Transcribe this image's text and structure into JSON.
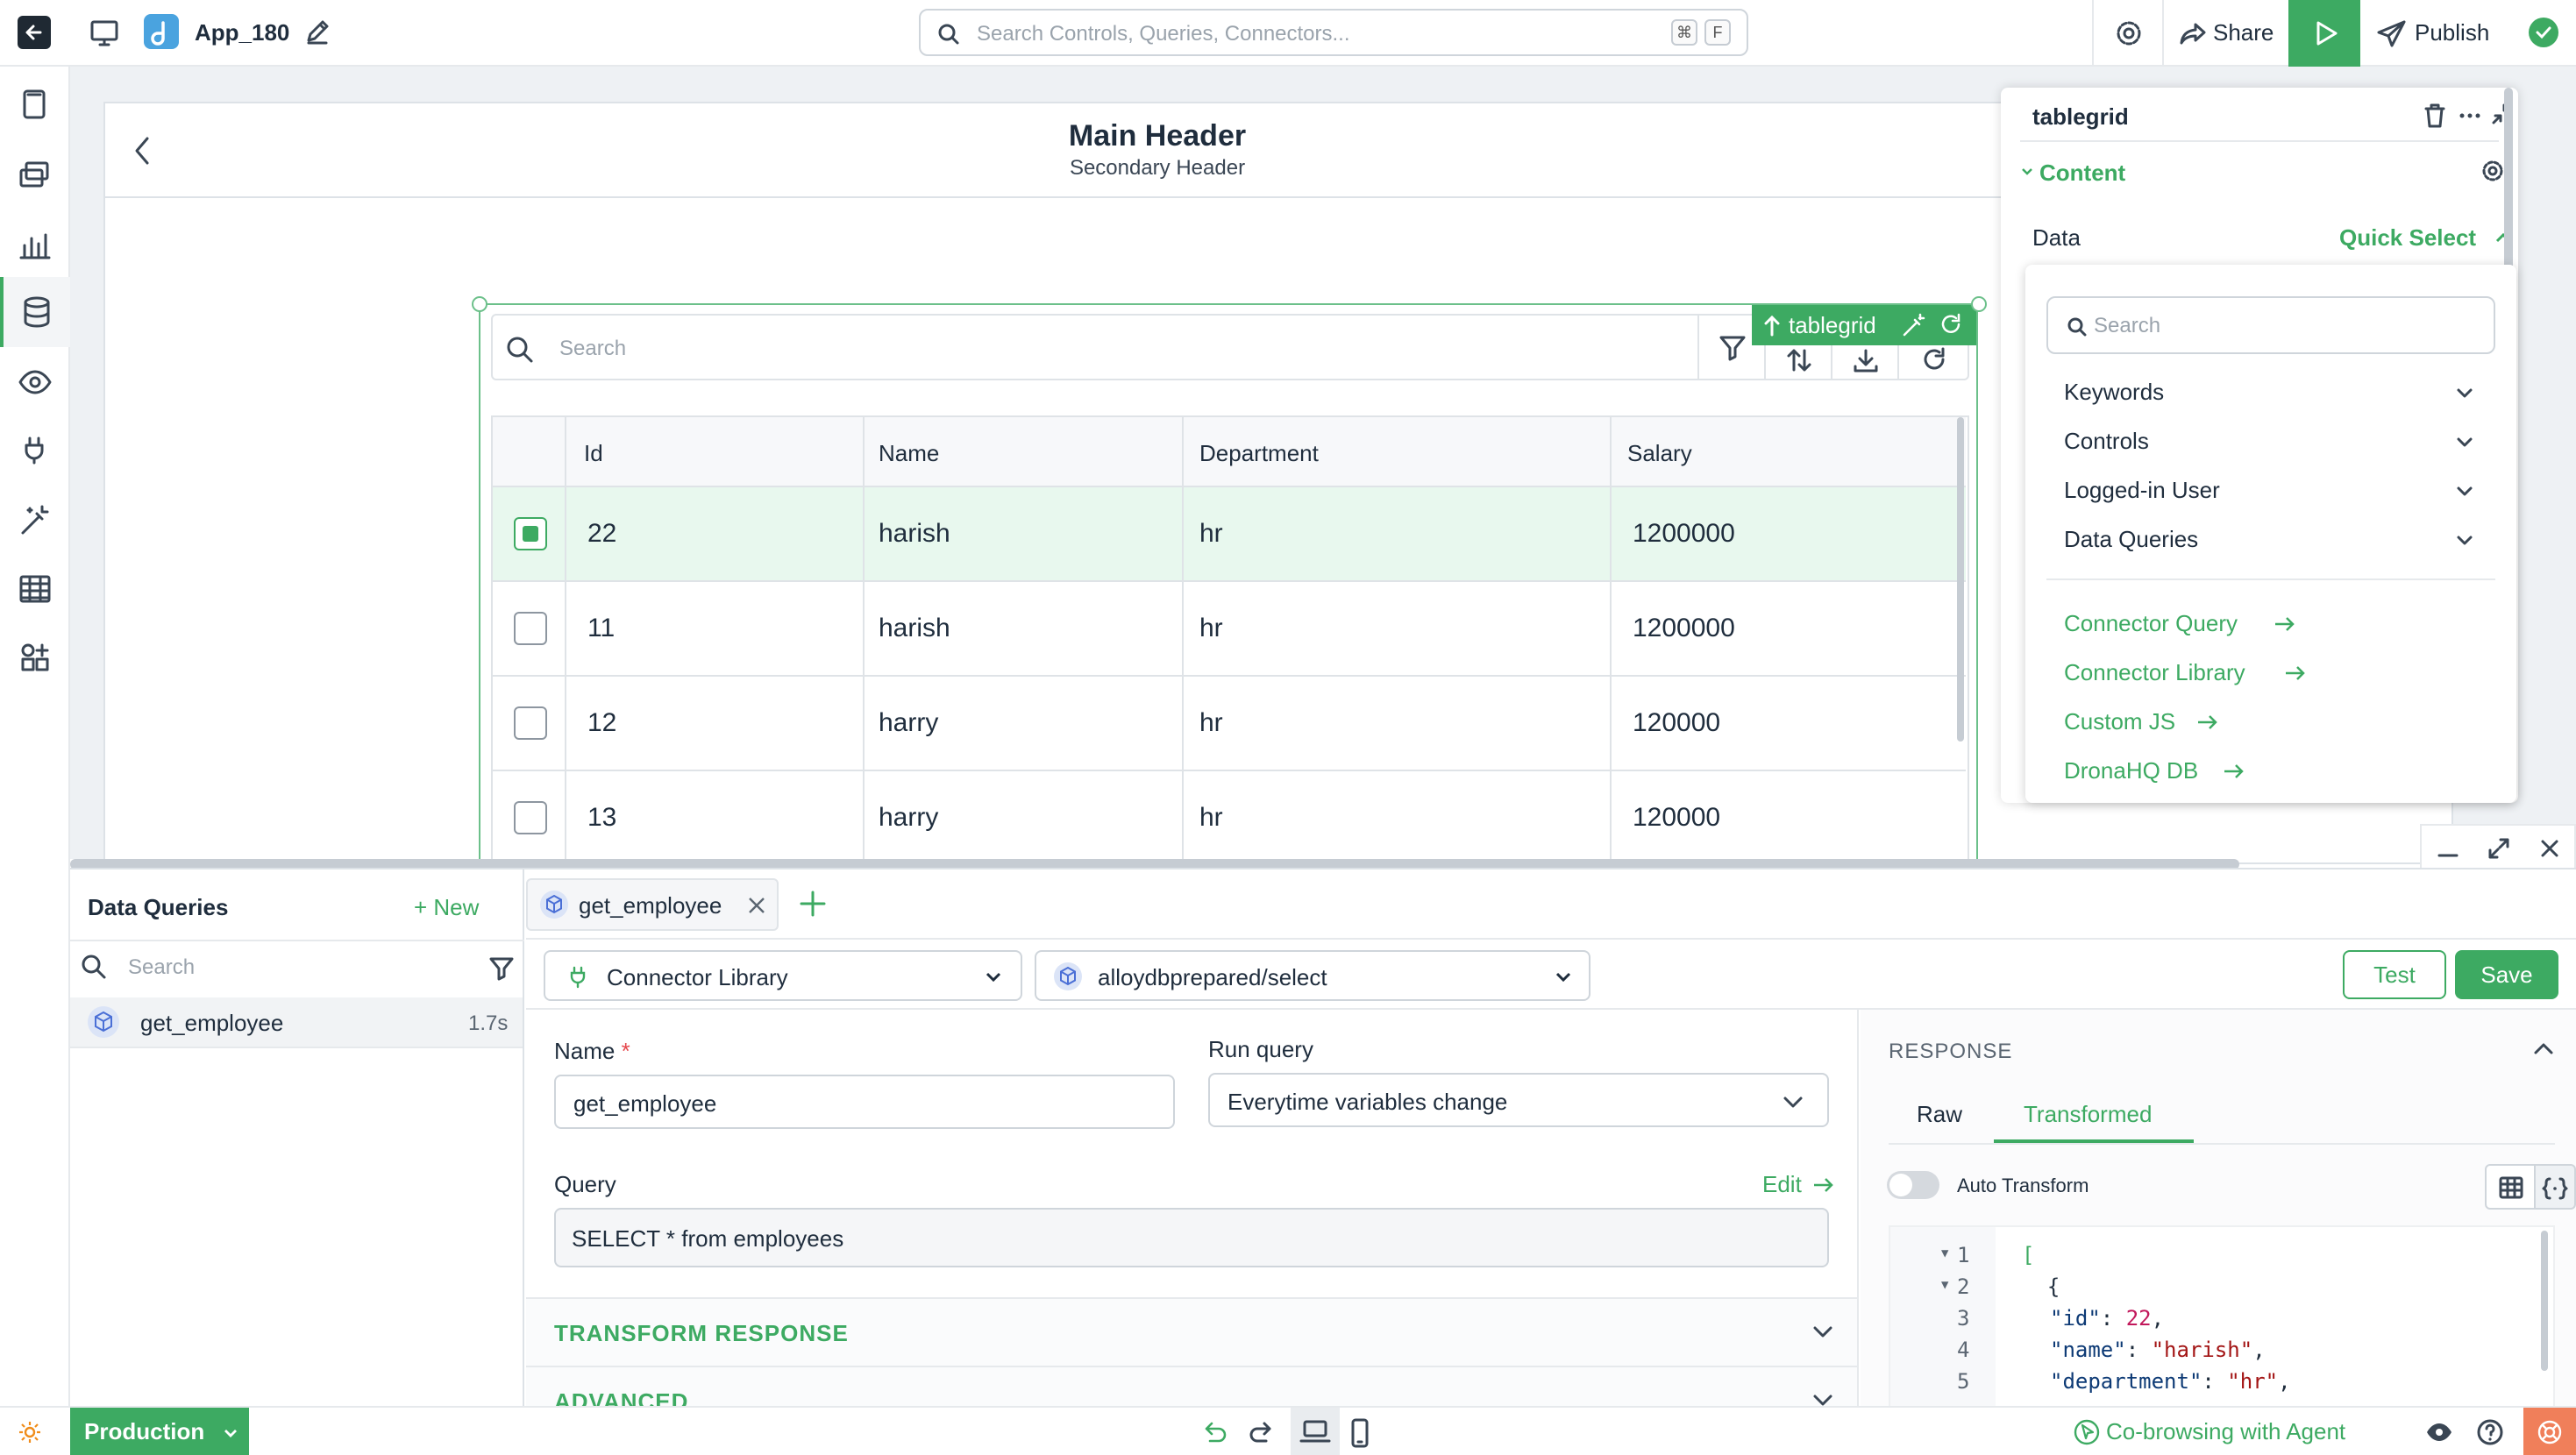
{
  "app": {
    "name": "App_180"
  },
  "global_search": {
    "placeholder": "Search Controls, Queries, Connectors...",
    "kbd1": "⌘",
    "kbd2": "F"
  },
  "toolbar": {
    "share": "Share",
    "publish": "Publish"
  },
  "header": {
    "main": "Main Header",
    "secondary": "Secondary Header"
  },
  "tablegrid": {
    "badge": "tablegrid",
    "search_placeholder": "Search",
    "columns": [
      "Id",
      "Name",
      "Department",
      "Salary"
    ],
    "rows": [
      {
        "id": "22",
        "name": "harish",
        "department": "hr",
        "salary": "1200000",
        "selected": true
      },
      {
        "id": "11",
        "name": "harish",
        "department": "hr",
        "salary": "1200000",
        "selected": false
      },
      {
        "id": "12",
        "name": "harry",
        "department": "hr",
        "salary": "120000",
        "selected": false
      },
      {
        "id": "13",
        "name": "harry",
        "department": "hr",
        "salary": "120000",
        "selected": false
      }
    ]
  },
  "props": {
    "title": "tablegrid",
    "section": "Content",
    "data_label": "Data",
    "quick_select": "Quick Select",
    "dropdown": {
      "search_placeholder": "Search",
      "groups": [
        "Keywords",
        "Controls",
        "Logged-in User",
        "Data Queries"
      ],
      "links": [
        "Connector Query",
        "Connector Library",
        "Custom JS",
        "DronaHQ DB"
      ]
    }
  },
  "queries": {
    "title": "Data Queries",
    "new": "+ New",
    "search_placeholder": "Search",
    "items": [
      {
        "name": "get_employee",
        "time": "1.7s"
      }
    ]
  },
  "editor": {
    "tab": "get_employee",
    "connector": "Connector Library",
    "endpoint": "alloydbprepared/select",
    "test": "Test",
    "save": "Save",
    "name_label": "Name",
    "required": "*",
    "name_value": "get_employee",
    "run_label": "Run query",
    "run_value": "Everytime variables change",
    "query_label": "Query",
    "edit": "Edit",
    "query_value": "SELECT * from employees",
    "transform": "TRANSFORM RESPONSE",
    "advanced": "ADVANCED"
  },
  "response": {
    "title": "RESPONSE",
    "tab_raw": "Raw",
    "tab_transformed": "Transformed",
    "auto_transform": "Auto Transform",
    "lines": [
      {
        "n": "1",
        "text": "["
      },
      {
        "n": "2",
        "text": "  {"
      },
      {
        "n": "3",
        "key": "\"id\"",
        "val": "22",
        "end": ","
      },
      {
        "n": "4",
        "key": "\"name\"",
        "val": "\"harish\"",
        "end": ","
      },
      {
        "n": "5",
        "key": "\"department\"",
        "val": "\"hr\"",
        "end": ","
      }
    ]
  },
  "bottombar": {
    "env": "Production",
    "cobrowse": "Co-browsing with Agent"
  },
  "colors": {
    "accent": "#3daa62",
    "selected_row": "#e8f8ee",
    "code_key": "#0d3a75",
    "code_string": "#a31515",
    "code_number": "#c2185b"
  }
}
